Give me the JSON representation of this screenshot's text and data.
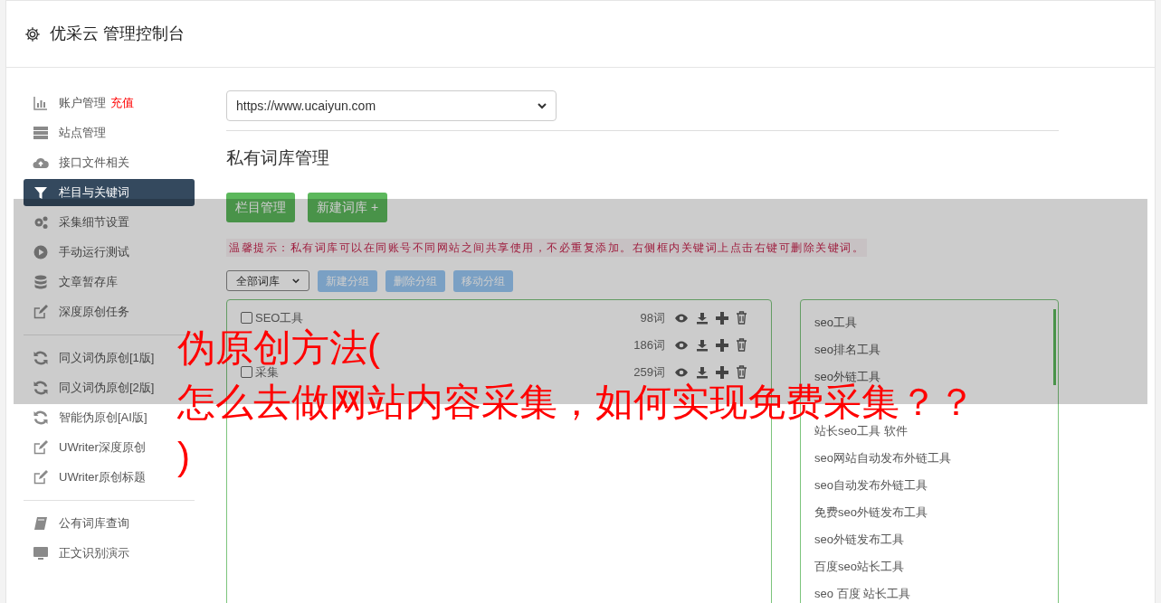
{
  "header": {
    "title": "优采云 管理控制台"
  },
  "sidebar": {
    "groups": [
      [
        {
          "label": "账户管理",
          "kind": "chart",
          "badge": "充值",
          "selected": false
        },
        {
          "label": "站点管理",
          "kind": "server",
          "selected": false
        },
        {
          "label": "接口文件相关",
          "kind": "cloud",
          "selected": false
        },
        {
          "label": "栏目与关键词",
          "kind": "filter",
          "selected": true
        },
        {
          "label": "采集细节设置",
          "kind": "gears",
          "selected": false
        },
        {
          "label": "手动运行测试",
          "kind": "play",
          "selected": false
        },
        {
          "label": "文章暂存库",
          "kind": "database",
          "selected": false
        },
        {
          "label": "深度原创任务",
          "kind": "edit",
          "selected": false
        }
      ],
      [
        {
          "label": "同义词伪原创[1版]",
          "kind": "refresh",
          "selected": false
        },
        {
          "label": "同义词伪原创[2版]",
          "kind": "refresh",
          "selected": false
        },
        {
          "label": "智能伪原创[AI版]",
          "kind": "refresh",
          "selected": false
        },
        {
          "label": "UWriter深度原创",
          "kind": "edit",
          "selected": false
        },
        {
          "label": "UWriter原创标题",
          "kind": "edit",
          "selected": false
        }
      ],
      [
        {
          "label": "公有词库查询",
          "kind": "book",
          "selected": false
        },
        {
          "label": "正文识别演示",
          "kind": "monitor",
          "selected": false
        }
      ]
    ]
  },
  "site_select": {
    "value": "https://www.ucaiyun.com"
  },
  "heading": "私有词库管理",
  "buttons": [
    "栏目管理",
    "新建词库 +"
  ],
  "notice": "温馨提示：私有词库可以在同账号不同网站之间共享使用，不必重复添加。右侧框内关键词上点击右键可删除关键词。",
  "group_select": {
    "value": "全部词库"
  },
  "group_buttons": [
    "新建分组",
    "删除分组",
    "移动分组"
  ],
  "lexicons": [
    {
      "name": "SEO工具",
      "count": "98词",
      "checked": false
    },
    {
      "count": "186词"
    },
    {
      "name": "采集",
      "count": "259词",
      "checked": false
    }
  ],
  "keywords": [
    "seo工具",
    "seo排名工具",
    "seo外链工具",
    "站长seo工具 软件",
    "seo网站自动发布外链工具",
    "seo自动发布外链工具",
    "免费seo外链发布工具",
    "seo外链发布工具",
    "百度seo站长工具",
    "seo 百度 站长工具"
  ],
  "overlay_title": [
    "伪原创方法(",
    "怎么去做网站内容采集，如何实现免费采集？？",
    ")"
  ]
}
